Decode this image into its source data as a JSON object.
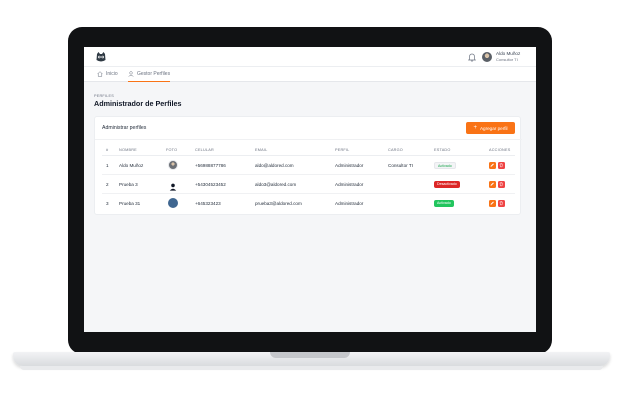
{
  "user": {
    "name": "Aldo Muñoz",
    "role": "Consultor TI"
  },
  "nav": [
    {
      "label": "Inicio",
      "icon": "home-icon",
      "active": false
    },
    {
      "label": "Gestor Perfiles",
      "icon": "user-icon",
      "active": true
    }
  ],
  "page": {
    "breadcrumb": "PERFILES",
    "title": "Administrador de Perfiles"
  },
  "card": {
    "title": "Administrar perfiles",
    "add_button": "Agregar perfil"
  },
  "table": {
    "headers": [
      "#",
      "NOMBRE",
      "FOTO",
      "CELULAR",
      "EMAIL",
      "PERFIL",
      "CARGO",
      "ESTADO",
      "ACCIONES"
    ],
    "rows": [
      {
        "num": "1",
        "name": "Aldo Muñoz",
        "phone": "+56988877786",
        "email": "aldo@aldored.com",
        "role": "Administrador",
        "cargo": "Consultor TI",
        "status": "Activado"
      },
      {
        "num": "2",
        "name": "Prueba 3",
        "phone": "+54304523452",
        "email": "aldo3@aldored.com",
        "role": "Administrador",
        "cargo": "",
        "status": "Desactivado"
      },
      {
        "num": "3",
        "name": "Prueba 31",
        "phone": "+645323423",
        "email": "prueba3@aldored.com",
        "role": "Administrador",
        "cargo": "",
        "status": "Activado"
      }
    ]
  },
  "colors": {
    "accent": "#f97316",
    "danger": "#ef4444",
    "success": "#22c55e"
  }
}
